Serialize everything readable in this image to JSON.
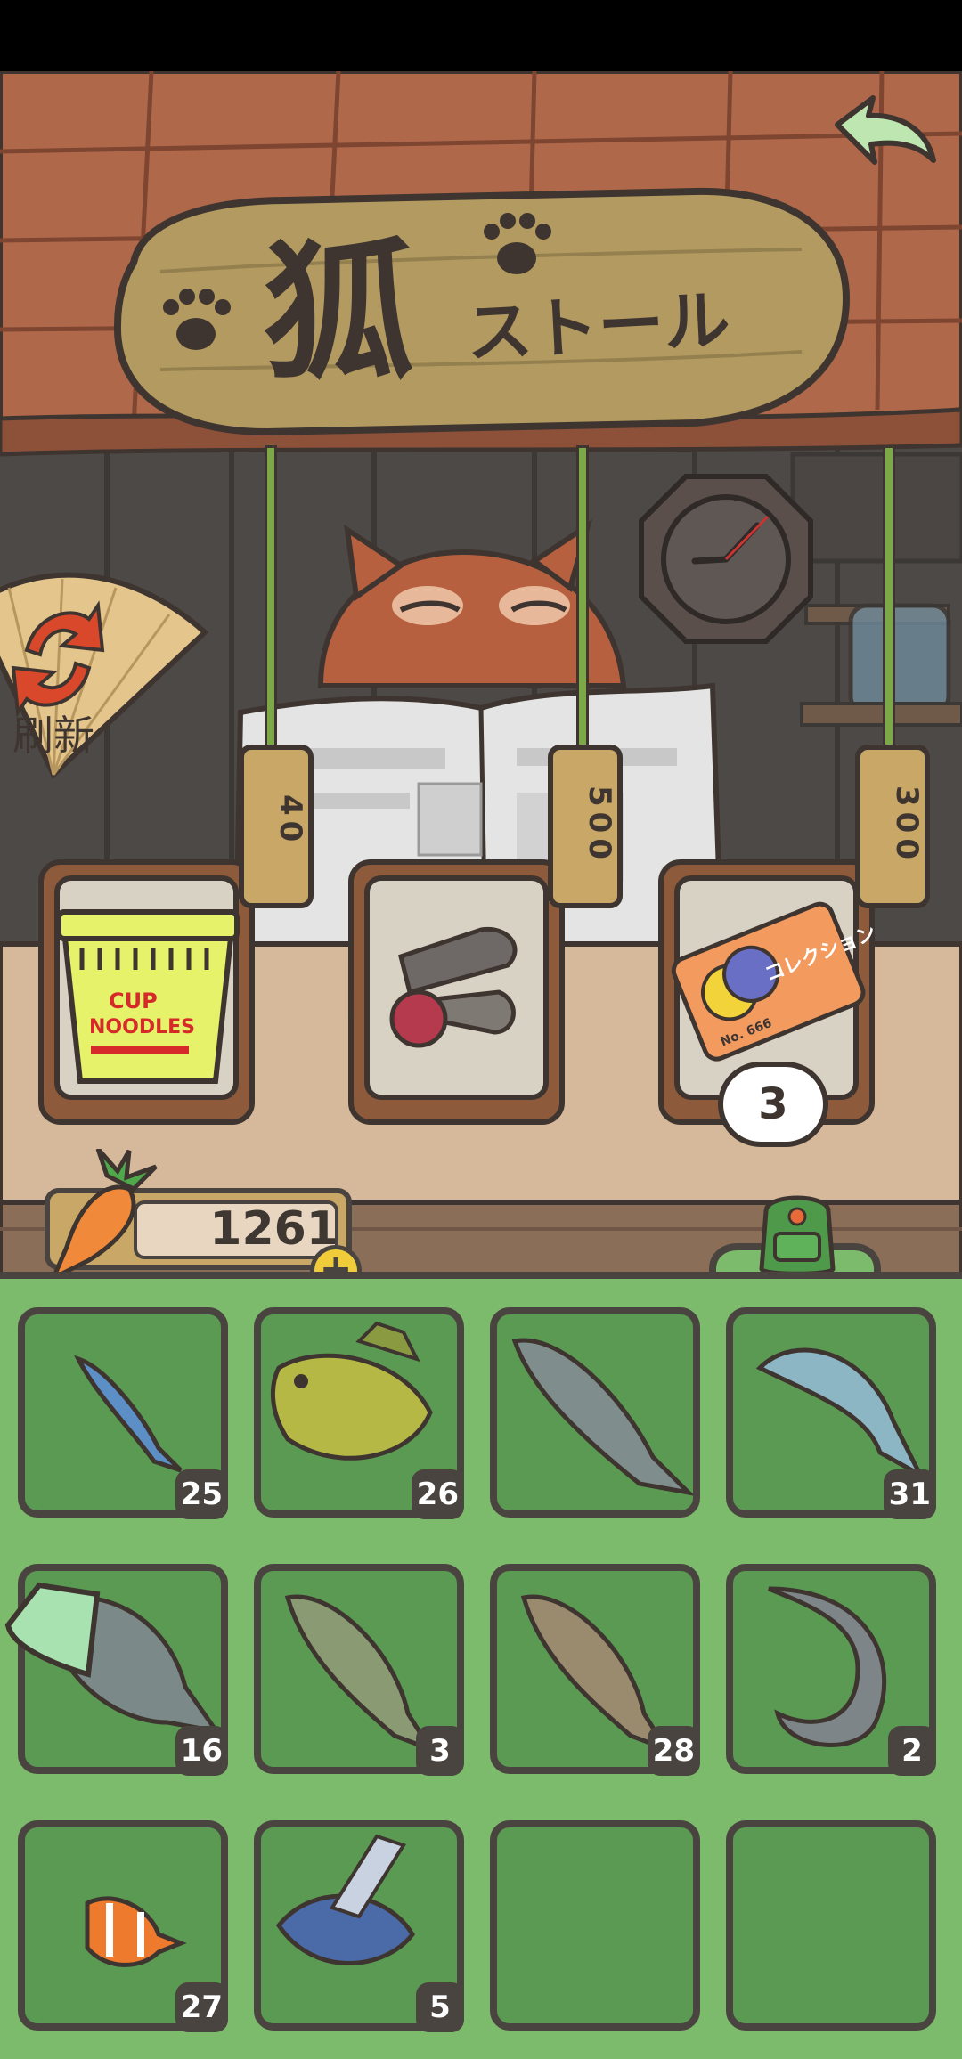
{
  "shop": {
    "sign_kanji": "狐",
    "sign_katakana": "ストール",
    "refresh_label": "刷新",
    "items": [
      {
        "name": "cup-noodles",
        "label_line1": "CUP",
        "label_line2": "NOODLES",
        "price": "40"
      },
      {
        "name": "bait-set",
        "price": "500"
      },
      {
        "name": "collection-ticket",
        "ticket_text": "コレクション",
        "ticket_number": "No. 666",
        "price": "300",
        "quantity": "3"
      }
    ]
  },
  "currency": {
    "icon": "carrot-icon",
    "amount": "1261"
  },
  "inventory": {
    "slots": [
      {
        "icon": "sardine-icon",
        "count": "25"
      },
      {
        "icon": "sunfish-icon",
        "count": "26"
      },
      {
        "icon": "salmon-icon",
        "count": ""
      },
      {
        "icon": "mackerel-icon",
        "count": "31"
      },
      {
        "icon": "carp-icon",
        "count": "16"
      },
      {
        "icon": "bass-icon",
        "count": "3"
      },
      {
        "icon": "trout-icon",
        "count": "28"
      },
      {
        "icon": "sturgeon-icon",
        "count": "2"
      },
      {
        "icon": "clownfish-icon",
        "count": "27"
      },
      {
        "icon": "flying-fish-icon",
        "count": "5"
      },
      {
        "icon": "",
        "count": ""
      },
      {
        "icon": "",
        "count": ""
      }
    ]
  }
}
